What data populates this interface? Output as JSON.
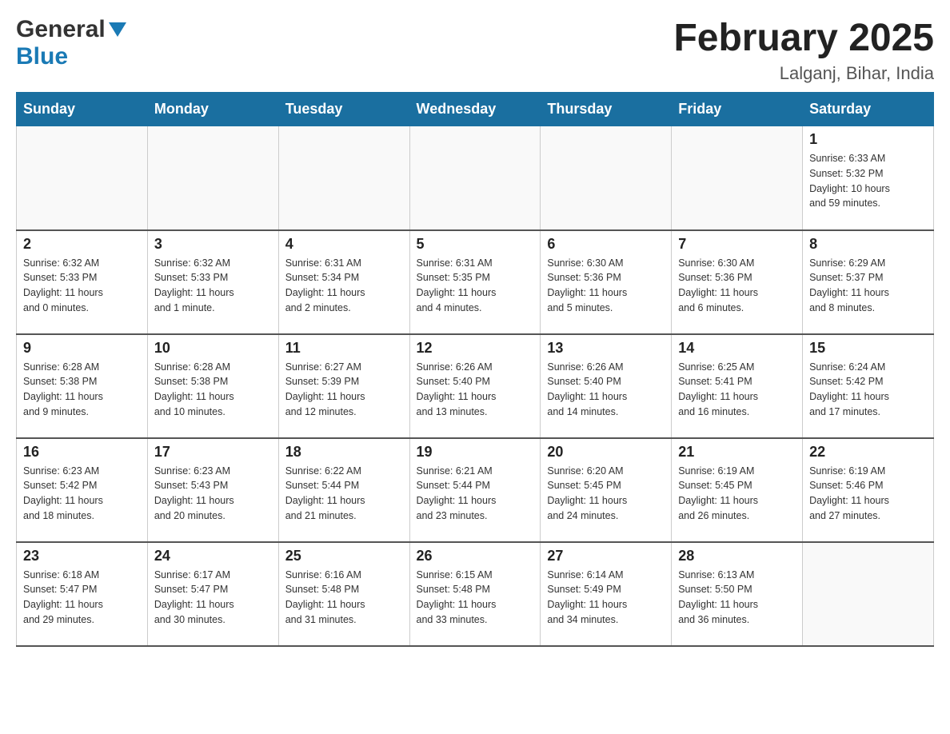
{
  "header": {
    "logo_general": "General",
    "logo_blue": "Blue",
    "month_title": "February 2025",
    "location": "Lalganj, Bihar, India"
  },
  "weekdays": [
    "Sunday",
    "Monday",
    "Tuesday",
    "Wednesday",
    "Thursday",
    "Friday",
    "Saturday"
  ],
  "weeks": [
    [
      {
        "day": "",
        "info": ""
      },
      {
        "day": "",
        "info": ""
      },
      {
        "day": "",
        "info": ""
      },
      {
        "day": "",
        "info": ""
      },
      {
        "day": "",
        "info": ""
      },
      {
        "day": "",
        "info": ""
      },
      {
        "day": "1",
        "info": "Sunrise: 6:33 AM\nSunset: 5:32 PM\nDaylight: 10 hours\nand 59 minutes."
      }
    ],
    [
      {
        "day": "2",
        "info": "Sunrise: 6:32 AM\nSunset: 5:33 PM\nDaylight: 11 hours\nand 0 minutes."
      },
      {
        "day": "3",
        "info": "Sunrise: 6:32 AM\nSunset: 5:33 PM\nDaylight: 11 hours\nand 1 minute."
      },
      {
        "day": "4",
        "info": "Sunrise: 6:31 AM\nSunset: 5:34 PM\nDaylight: 11 hours\nand 2 minutes."
      },
      {
        "day": "5",
        "info": "Sunrise: 6:31 AM\nSunset: 5:35 PM\nDaylight: 11 hours\nand 4 minutes."
      },
      {
        "day": "6",
        "info": "Sunrise: 6:30 AM\nSunset: 5:36 PM\nDaylight: 11 hours\nand 5 minutes."
      },
      {
        "day": "7",
        "info": "Sunrise: 6:30 AM\nSunset: 5:36 PM\nDaylight: 11 hours\nand 6 minutes."
      },
      {
        "day": "8",
        "info": "Sunrise: 6:29 AM\nSunset: 5:37 PM\nDaylight: 11 hours\nand 8 minutes."
      }
    ],
    [
      {
        "day": "9",
        "info": "Sunrise: 6:28 AM\nSunset: 5:38 PM\nDaylight: 11 hours\nand 9 minutes."
      },
      {
        "day": "10",
        "info": "Sunrise: 6:28 AM\nSunset: 5:38 PM\nDaylight: 11 hours\nand 10 minutes."
      },
      {
        "day": "11",
        "info": "Sunrise: 6:27 AM\nSunset: 5:39 PM\nDaylight: 11 hours\nand 12 minutes."
      },
      {
        "day": "12",
        "info": "Sunrise: 6:26 AM\nSunset: 5:40 PM\nDaylight: 11 hours\nand 13 minutes."
      },
      {
        "day": "13",
        "info": "Sunrise: 6:26 AM\nSunset: 5:40 PM\nDaylight: 11 hours\nand 14 minutes."
      },
      {
        "day": "14",
        "info": "Sunrise: 6:25 AM\nSunset: 5:41 PM\nDaylight: 11 hours\nand 16 minutes."
      },
      {
        "day": "15",
        "info": "Sunrise: 6:24 AM\nSunset: 5:42 PM\nDaylight: 11 hours\nand 17 minutes."
      }
    ],
    [
      {
        "day": "16",
        "info": "Sunrise: 6:23 AM\nSunset: 5:42 PM\nDaylight: 11 hours\nand 18 minutes."
      },
      {
        "day": "17",
        "info": "Sunrise: 6:23 AM\nSunset: 5:43 PM\nDaylight: 11 hours\nand 20 minutes."
      },
      {
        "day": "18",
        "info": "Sunrise: 6:22 AM\nSunset: 5:44 PM\nDaylight: 11 hours\nand 21 minutes."
      },
      {
        "day": "19",
        "info": "Sunrise: 6:21 AM\nSunset: 5:44 PM\nDaylight: 11 hours\nand 23 minutes."
      },
      {
        "day": "20",
        "info": "Sunrise: 6:20 AM\nSunset: 5:45 PM\nDaylight: 11 hours\nand 24 minutes."
      },
      {
        "day": "21",
        "info": "Sunrise: 6:19 AM\nSunset: 5:45 PM\nDaylight: 11 hours\nand 26 minutes."
      },
      {
        "day": "22",
        "info": "Sunrise: 6:19 AM\nSunset: 5:46 PM\nDaylight: 11 hours\nand 27 minutes."
      }
    ],
    [
      {
        "day": "23",
        "info": "Sunrise: 6:18 AM\nSunset: 5:47 PM\nDaylight: 11 hours\nand 29 minutes."
      },
      {
        "day": "24",
        "info": "Sunrise: 6:17 AM\nSunset: 5:47 PM\nDaylight: 11 hours\nand 30 minutes."
      },
      {
        "day": "25",
        "info": "Sunrise: 6:16 AM\nSunset: 5:48 PM\nDaylight: 11 hours\nand 31 minutes."
      },
      {
        "day": "26",
        "info": "Sunrise: 6:15 AM\nSunset: 5:48 PM\nDaylight: 11 hours\nand 33 minutes."
      },
      {
        "day": "27",
        "info": "Sunrise: 6:14 AM\nSunset: 5:49 PM\nDaylight: 11 hours\nand 34 minutes."
      },
      {
        "day": "28",
        "info": "Sunrise: 6:13 AM\nSunset: 5:50 PM\nDaylight: 11 hours\nand 36 minutes."
      },
      {
        "day": "",
        "info": ""
      }
    ]
  ]
}
